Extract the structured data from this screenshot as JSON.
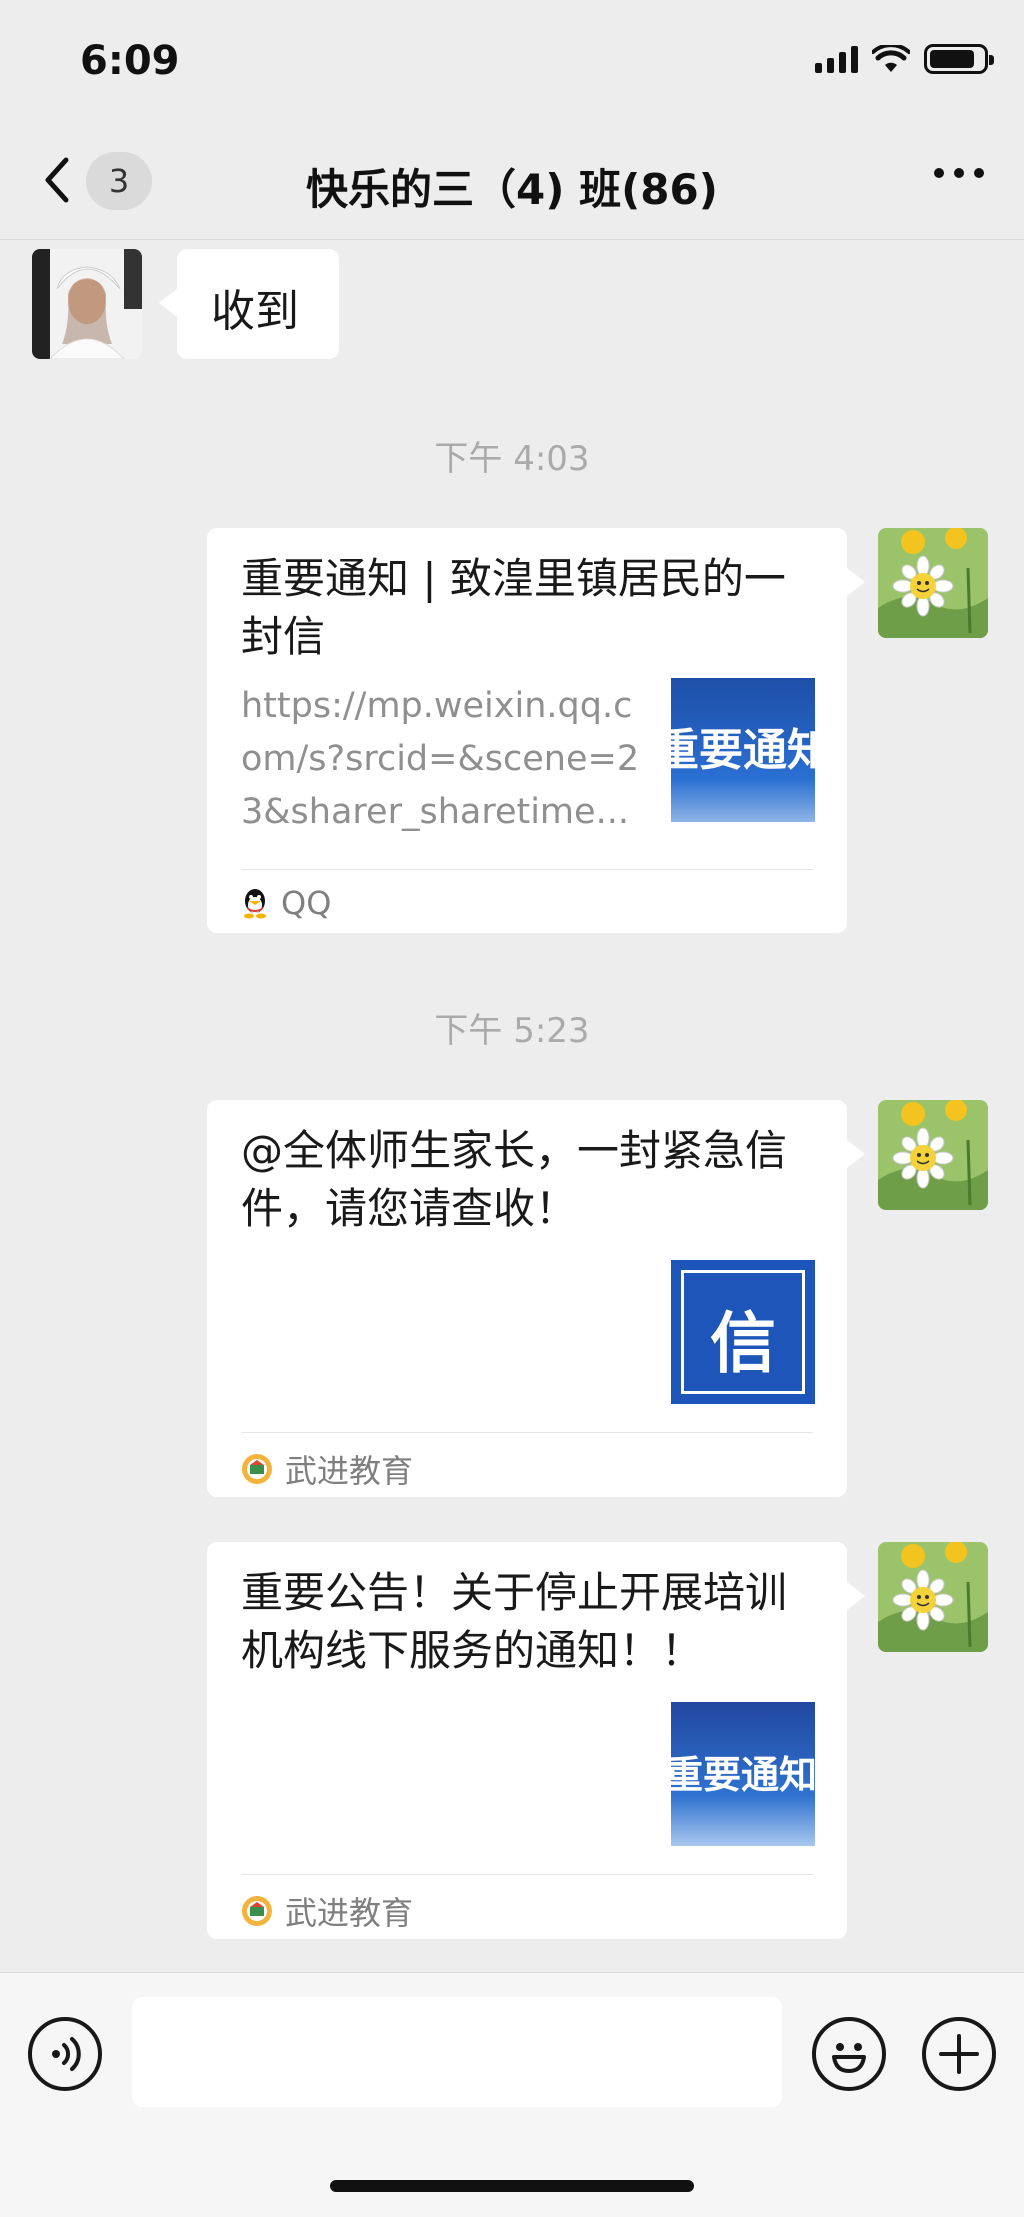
{
  "status_bar": {
    "time": "6:09",
    "battery_level": 0.85
  },
  "nav": {
    "back_badge": "3",
    "title": "快乐的三（4) 班(86)"
  },
  "messages": [
    {
      "type": "text",
      "side": "left",
      "text": "收到"
    },
    {
      "type": "timestamp",
      "text": "下午 4:03"
    },
    {
      "type": "link_card",
      "side": "right",
      "title": "重要通知 | 致湟里镇居民的一封信",
      "description": "https://mp.weixin.qq.com/s?srcid=&scene=23&sharer_sharetime...",
      "thumb_text": "重要通知",
      "source": "QQ",
      "source_icon": "qq-penguin-icon"
    },
    {
      "type": "timestamp",
      "text": "下午 5:23"
    },
    {
      "type": "link_card",
      "side": "right",
      "title": "@全体师生家长，一封紧急信件，请您请查收！",
      "thumb_text": "信",
      "source": "武进教育",
      "source_icon": "wujin-education-logo-icon"
    },
    {
      "type": "link_card",
      "side": "right",
      "title": "重要公告！关于停止开展培训机构线下服务的通知！！",
      "thumb_text": "重要通知",
      "source": "武进教育",
      "source_icon": "wujin-education-logo-icon"
    }
  ],
  "colors": {
    "background": "#ededed",
    "bubble": "#ffffff",
    "thumb_blue": "#1d55b8"
  }
}
